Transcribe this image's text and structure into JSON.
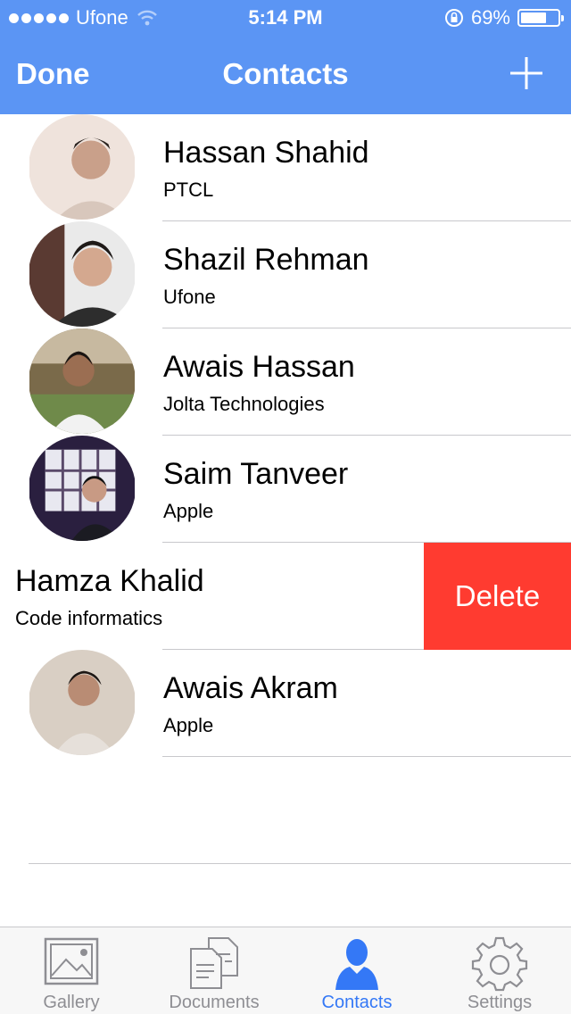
{
  "status_bar": {
    "carrier": "Ufone",
    "time": "5:14 PM",
    "battery": "69%",
    "battery_level": 0.69
  },
  "nav": {
    "left_button": "Done",
    "title": "Contacts",
    "right_icon": "plus-icon"
  },
  "contacts": [
    {
      "name": "Hassan Shahid",
      "company": "PTCL"
    },
    {
      "name": "Shazil Rehman",
      "company": "Ufone"
    },
    {
      "name": "Awais Hassan",
      "company": "Jolta Technologies"
    },
    {
      "name": "Saim Tanveer",
      "company": "Apple"
    },
    {
      "name": "Hamza Khalid",
      "company": "Code informatics",
      "swiped": true,
      "action": "Delete"
    },
    {
      "name": "Awais Akram",
      "company": "Apple"
    }
  ],
  "tabs": [
    {
      "label": "Gallery",
      "icon": "gallery-icon",
      "active": false
    },
    {
      "label": "Documents",
      "icon": "documents-icon",
      "active": false
    },
    {
      "label": "Contacts",
      "icon": "contacts-icon",
      "active": true
    },
    {
      "label": "Settings",
      "icon": "gear-icon",
      "active": false
    }
  ],
  "colors": {
    "header": "#5B95F4",
    "delete": "#FF3B30",
    "tab_active": "#3478F6",
    "tab_inactive": "#8e8e93"
  }
}
